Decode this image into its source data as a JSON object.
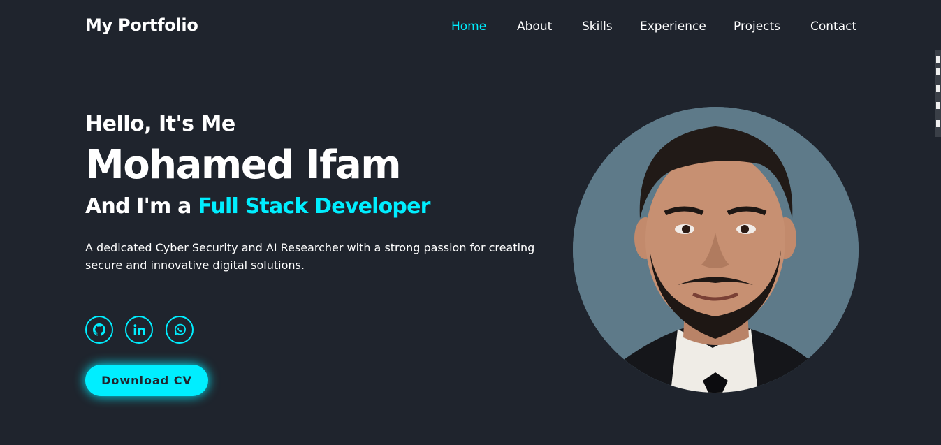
{
  "header": {
    "logo": "My Portfolio",
    "nav": [
      {
        "label": "Home",
        "active": true
      },
      {
        "label": "About",
        "active": false
      },
      {
        "label": "Skills",
        "active": false
      },
      {
        "label": "Experience",
        "active": false
      },
      {
        "label": "Projects",
        "active": false
      },
      {
        "label": "Contact",
        "active": false
      }
    ]
  },
  "hero": {
    "greeting": "Hello, It's Me",
    "name": "Mohamed Ifam",
    "role_prefix": "And I'm a",
    "role": "Full Stack Developer",
    "description": "A dedicated Cyber Security and AI Researcher with a strong passion for creating secure and innovative digital solutions.",
    "socials": [
      {
        "icon": "github-icon"
      },
      {
        "icon": "linkedin-icon"
      },
      {
        "icon": "whatsapp-icon"
      }
    ],
    "cta_label": "Download CV"
  },
  "colors": {
    "background": "#1f242d",
    "accent": "#00eeff",
    "text": "#ffffff",
    "photo_background": "#5e7a89"
  }
}
